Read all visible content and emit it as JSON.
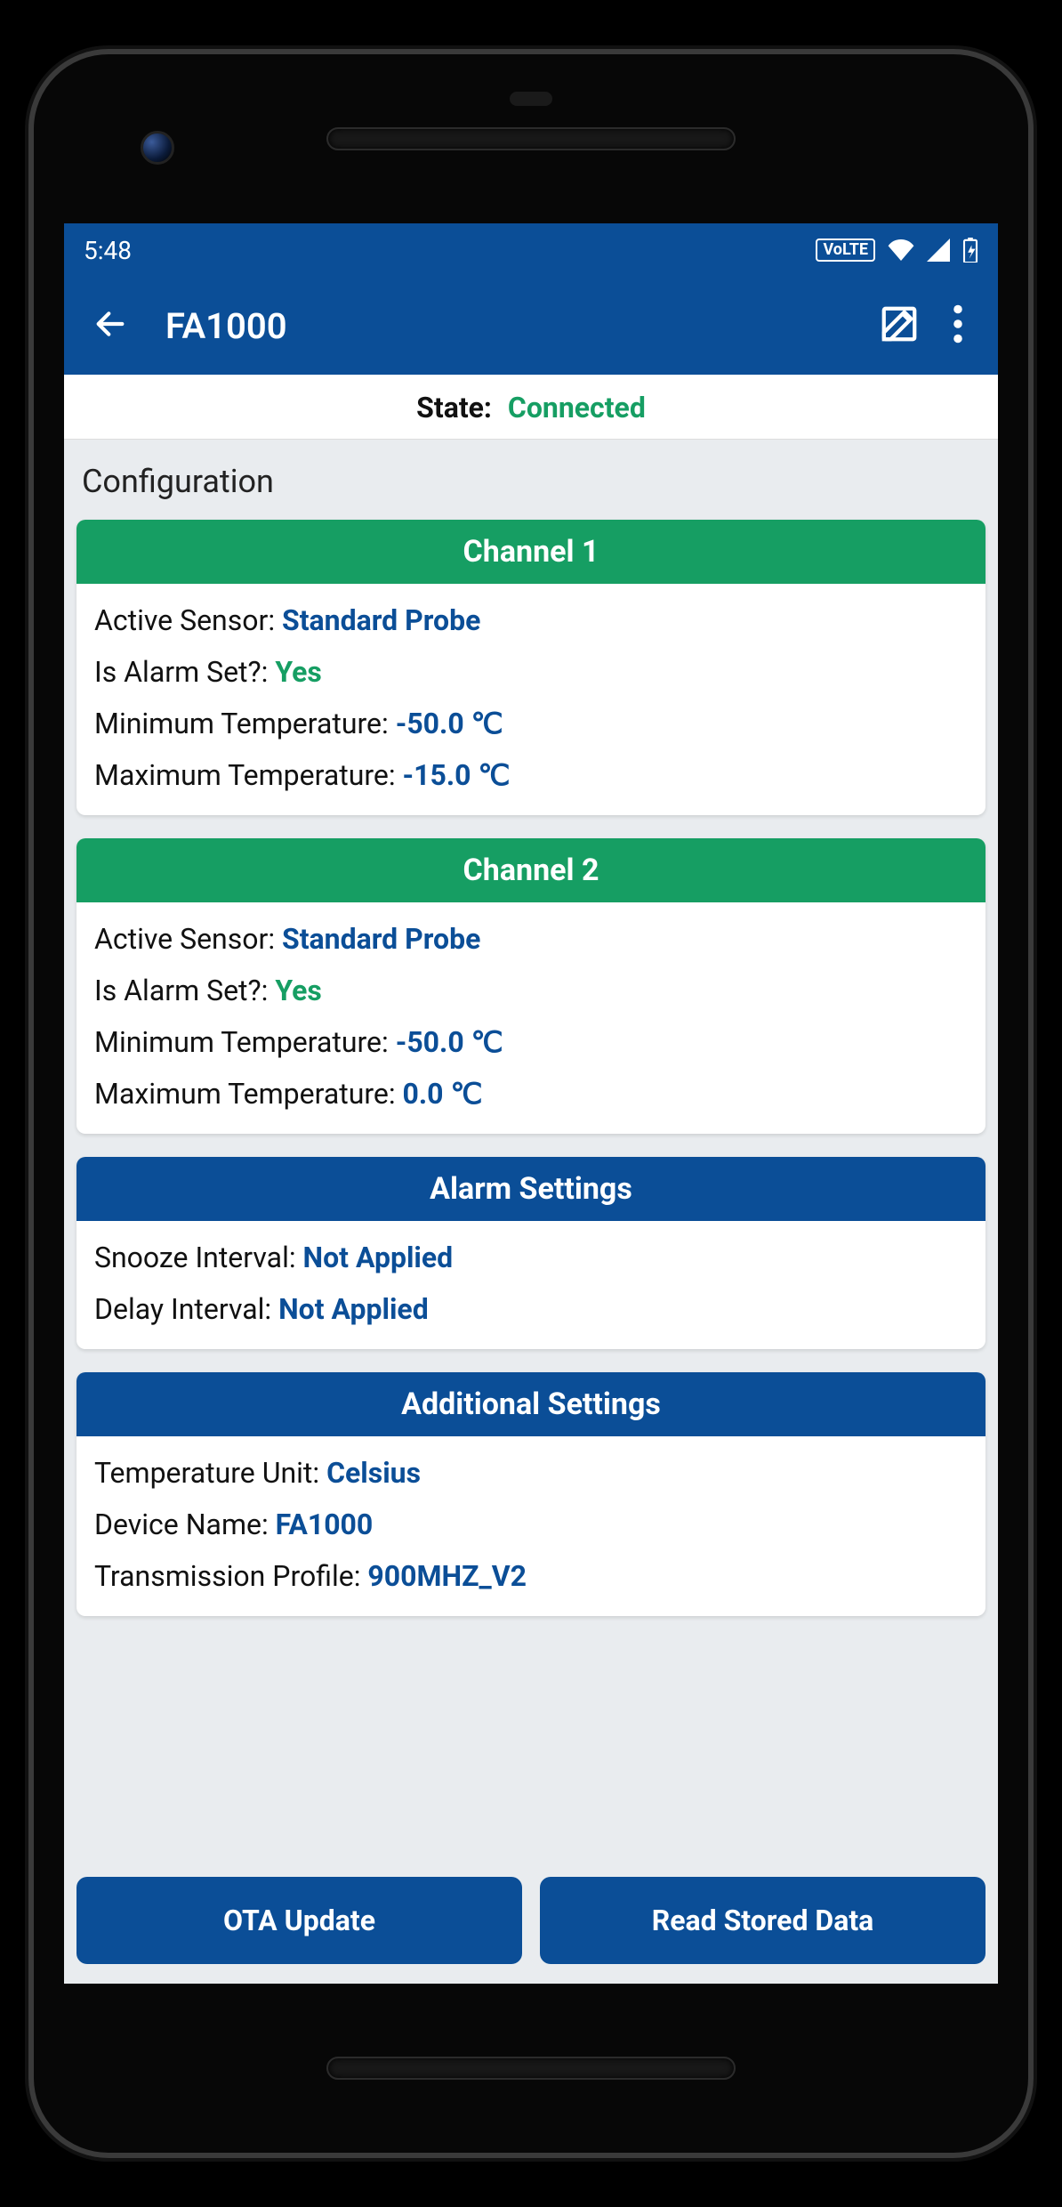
{
  "statusbar": {
    "time": "5:48",
    "volte": "VoLTE"
  },
  "appbar": {
    "title": "FA1000"
  },
  "state": {
    "label": "State:",
    "value": "Connected"
  },
  "sectionTitle": "Configuration",
  "channel1": {
    "header": "Channel 1",
    "activeSensorLabel": "Active Sensor: ",
    "activeSensor": "Standard Probe",
    "alarmLabel": "Is Alarm Set?: ",
    "alarm": "Yes",
    "minLabel": "Minimum Temperature: ",
    "min": "-50.0 ℃",
    "maxLabel": "Maximum Temperature: ",
    "max": "-15.0 ℃"
  },
  "channel2": {
    "header": "Channel 2",
    "activeSensorLabel": "Active Sensor: ",
    "activeSensor": "Standard Probe",
    "alarmLabel": "Is Alarm Set?: ",
    "alarm": "Yes",
    "minLabel": "Minimum Temperature: ",
    "min": "-50.0 ℃",
    "maxLabel": "Maximum Temperature: ",
    "max": "0.0 ℃"
  },
  "alarmSettings": {
    "header": "Alarm Settings",
    "snoozeLabel": "Snooze Interval: ",
    "snooze": "Not Applied",
    "delayLabel": "Delay Interval: ",
    "delay": "Not Applied"
  },
  "additional": {
    "header": "Additional Settings",
    "unitLabel": "Temperature Unit: ",
    "unit": "Celsius",
    "deviceLabel": "Device Name: ",
    "device": "FA1000",
    "profileLabel": "Transmission Profile: ",
    "profile": "900MHZ_V2"
  },
  "buttons": {
    "ota": "OTA Update",
    "read": "Read Stored Data"
  }
}
